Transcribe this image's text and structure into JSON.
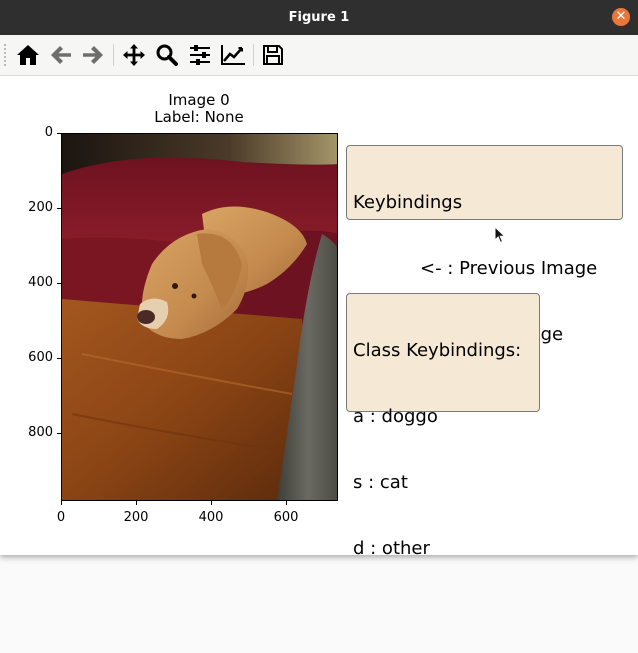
{
  "window": {
    "title": "Figure 1",
    "close_glyph": "✕"
  },
  "toolbar": {
    "buttons": [
      {
        "name": "home-icon",
        "tooltip": "Reset original view"
      },
      {
        "name": "back-arrow-icon",
        "tooltip": "Back to previous view"
      },
      {
        "name": "forward-arrow-icon",
        "tooltip": "Forward to next view"
      },
      {
        "name": "pan-move-icon",
        "tooltip": "Pan axes"
      },
      {
        "name": "zoom-magnifier-icon",
        "tooltip": "Zoom to rectangle"
      },
      {
        "name": "configure-subplots-icon",
        "tooltip": "Configure subplots"
      },
      {
        "name": "edit-axis-icon",
        "tooltip": "Edit axis, curve and image parameters"
      },
      {
        "name": "save-floppy-icon",
        "tooltip": "Save the figure"
      }
    ]
  },
  "plot": {
    "title_line1": "Image 0",
    "title_line2": "Label: None",
    "image_description": "golden retriever resting head on wooden table beside red couch",
    "y_ticks": [
      "0",
      "200",
      "400",
      "600",
      "800"
    ],
    "x_ticks": [
      "0",
      "200",
      "400",
      "600"
    ]
  },
  "keybindings_box": {
    "heading": "Keybindings",
    "line1": "<- : Previous Image",
    "line2": "-> : Next Image"
  },
  "class_box": {
    "heading": "Class Keybindings:",
    "line1": "a : doggo",
    "line2": "s : cat",
    "line3": "d : other"
  },
  "colors": {
    "titlebar": "#2f2f2f",
    "close_button": "#e9773b",
    "toolbar": "#f6f6f5",
    "textbox_bg": "#f5e9d6"
  }
}
